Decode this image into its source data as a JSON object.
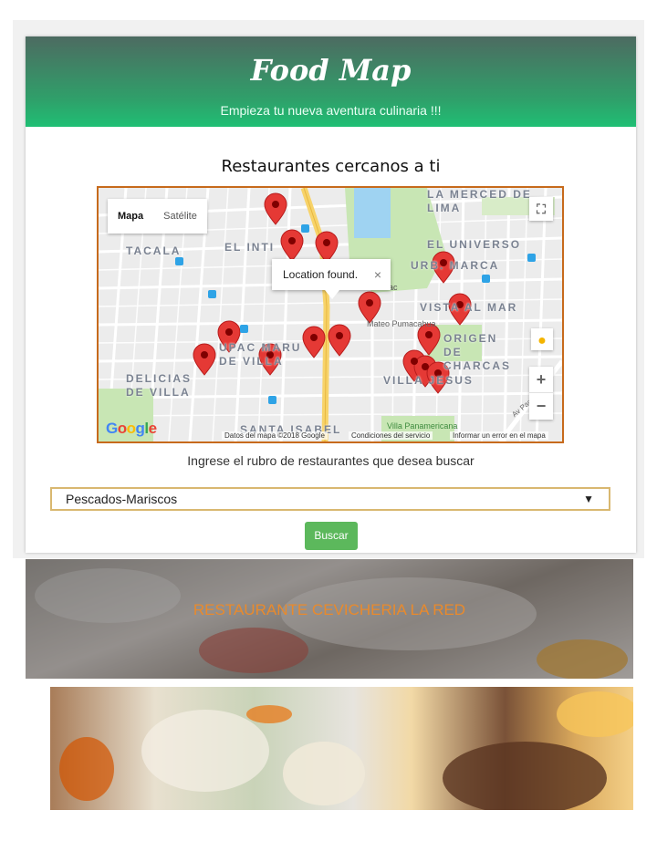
{
  "header": {
    "brand": "Food Map",
    "tagline": "Empieza tu nueva aventura culinaria !!!"
  },
  "nearby": {
    "title": "Restaurantes cercanos a ti"
  },
  "map": {
    "type_buttons": [
      "Mapa",
      "Satélite"
    ],
    "popup_text": "Location found.",
    "popup_close": "×",
    "labels": [
      "LA MERCED DE LIMA",
      "EL UNIVERSO",
      "TACALA",
      "EL INTI",
      "URB. MARCA",
      "VISTA AL MAR",
      "ORIGEN DE CHARCAS",
      "UPAC MARU DE VILLA",
      "DELICIAS DE VILLA",
      "VILLA JESUS",
      "SANTA ISABEL",
      "Mateo Pumacahua",
      "Villa Panamericana",
      "Av Pachacutec",
      "Pac"
    ],
    "attribution": [
      "Datos del mapa ©2018 Google",
      "Condiciones del servicio",
      "Informar un error en el mapa"
    ],
    "logo": "Google",
    "zoom_in": "+",
    "zoom_out": "−",
    "accent_color": "#c76a1c",
    "marker_color": "#e53935"
  },
  "search": {
    "prompt": "Ingrese el rubro de restaurantes que desea buscar",
    "selected": "Pescados-Mariscos",
    "button": "Buscar"
  },
  "results": [
    {
      "name": "RESTAURANTE CEVICHERIA LA RED"
    }
  ]
}
